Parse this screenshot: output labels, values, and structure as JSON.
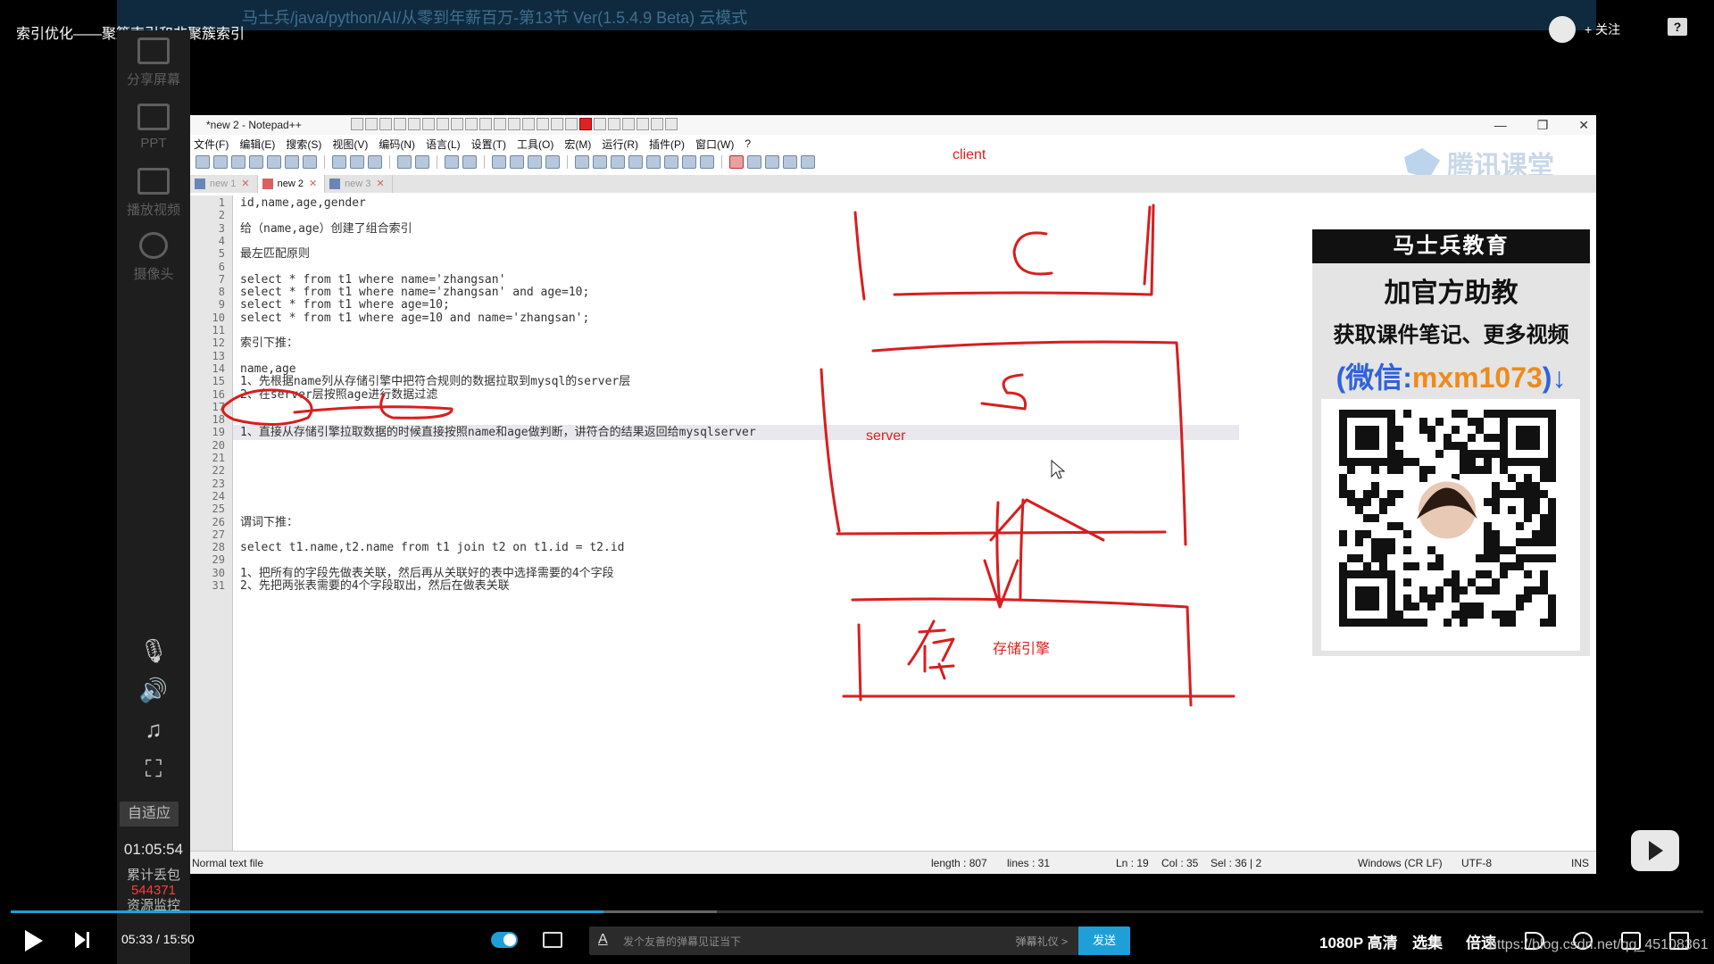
{
  "video_title": "索引优化——聚簇索引和非聚簇索引",
  "faded_window_title": "马士兵/java/python/AI/从零到年薪百万-第13节 Ver(1.5.4.9 Beta) 云模式",
  "follow_label": "+ 关注",
  "left_tools": [
    {
      "label": "分享屏幕",
      "icon": "share-screen-icon"
    },
    {
      "label": "PPT",
      "icon": "ppt-icon"
    },
    {
      "label": "播放视频",
      "icon": "play-video-icon"
    },
    {
      "label": "摄像头",
      "icon": "camera-icon"
    }
  ],
  "fit_label": "自适应",
  "clock": "01:05:54",
  "loss_label": "累计丢包",
  "loss_value": "544371",
  "resource_label": "资源监控",
  "notepad": {
    "title": "*new 2 - Notepad++",
    "menu": [
      "文件(F)",
      "编辑(E)",
      "搜索(S)",
      "视图(V)",
      "编码(N)",
      "语言(L)",
      "设置(T)",
      "工具(O)",
      "宏(M)",
      "运行(R)",
      "插件(P)",
      "窗口(W)",
      "?"
    ],
    "tabs": [
      {
        "label": "new 1",
        "active": false
      },
      {
        "label": "new 2",
        "active": true
      },
      {
        "label": "new 3",
        "active": false
      }
    ],
    "brand": "腾讯课堂",
    "lines": [
      "id,name,age,gender",
      "",
      "给（name,age）创建了组合索引",
      "",
      "最左匹配原则",
      "",
      "select * from t1 where name='zhangsan'",
      "select * from t1 where name='zhangsan' and age=10;",
      "select * from t1 where age=10;",
      "select * from t1 where age=10 and name='zhangsan';",
      "",
      "索引下推：",
      "",
      "name,age",
      "1、先根据name列从存储引擎中把符合规则的数据拉取到mysql的server层",
      "2、在server层按照age进行数据过滤",
      "",
      "",
      "1、直接从存储引擎拉取数据的时候直接按照name和age做判断，讲符合的结果返回给mysqlserver",
      "",
      "",
      "",
      "",
      "",
      "",
      "谓词下推：",
      "",
      "select t1.name,t2.name from t1 join t2 on t1.id = t2.id",
      "",
      "1、把所有的字段先做表关联，然后再从关联好的表中选择需要的4个字段",
      "2、先把两张表需要的4个字段取出，然后在做表关联"
    ],
    "status": {
      "type": "Normal text file",
      "length": "length : 807",
      "lines": "lines : 31",
      "ln": "Ln : 19",
      "col": "Col : 35",
      "sel": "Sel : 36 | 2",
      "eol": "Windows (CR LF)",
      "enc": "UTF-8",
      "mode": "INS"
    }
  },
  "whiteboard": {
    "client": "client",
    "server": "server",
    "storage": "存储引擎",
    "sketch_c": "C",
    "sketch_s": "S",
    "sketch_cun": "存",
    "ink_color": "#d81e1e"
  },
  "promo": {
    "header": "马士兵教育",
    "line1": "加官方助教",
    "line2": "获取课件笔记、更多视频",
    "line3_prefix": "(微信:",
    "wechat": "mxm1073",
    "line3_suffix": ")↓"
  },
  "player": {
    "current": "05:33",
    "separator": "/",
    "total": "15:50",
    "played_fraction": 0.35,
    "buffered_fraction": 0.417,
    "danmaku_placeholder": "发个友善的弹幕见证当下",
    "danmaku_gift": "弹幕礼仪 >",
    "send": "发送",
    "quality": "1080P 高清",
    "episodes": "选集",
    "speed": "倍速",
    "watermark": "https://blog.csdn.net/qq_45108361",
    "accent": "#1e9fd8"
  }
}
